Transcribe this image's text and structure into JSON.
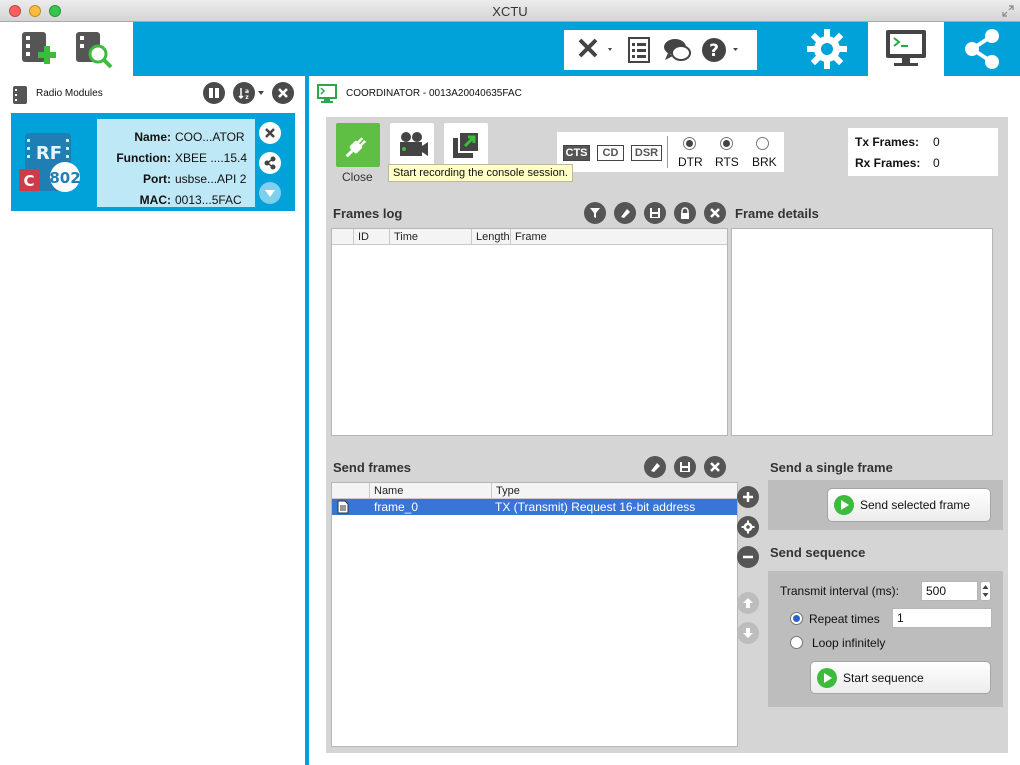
{
  "window": {
    "title": "XCTU"
  },
  "toolbar": {
    "icons": [
      "add-device-icon",
      "discover-devices-icon",
      "tools-icon",
      "frames-list-icon",
      "feedback-icon",
      "help-icon",
      "settings-icon",
      "console-icon",
      "network-icon"
    ],
    "accent": "#00a2d9"
  },
  "left": {
    "title": "Radio Modules",
    "module": {
      "badge_rf": "RF",
      "badge_c": "C",
      "badge_802": "802",
      "rows": [
        {
          "key": "Name:",
          "value": "COO...ATOR"
        },
        {
          "key": "Function:",
          "value": "XBEE ....15.4"
        },
        {
          "key": "Port:",
          "value": "usbse...API 2"
        },
        {
          "key": "MAC:",
          "value": "0013...5FAC"
        }
      ]
    }
  },
  "console": {
    "title": "COORDINATOR - 0013A20040635FAC",
    "close_label": "Close",
    "tooltip": "Start recording the console session.",
    "flow_labels": [
      "CTS",
      "CD",
      "DSR"
    ],
    "line_labels": [
      "DTR",
      "RTS",
      "BRK"
    ],
    "tx_label": "Tx Frames:",
    "tx_value": "0",
    "rx_label": "Rx Frames:",
    "rx_value": "0"
  },
  "frames_log": {
    "title": "Frames log",
    "columns": [
      "ID",
      "Time",
      "Length",
      "Frame"
    ],
    "details_title": "Frame details"
  },
  "send_frames": {
    "title": "Send frames",
    "columns": [
      "Name",
      "Type"
    ],
    "rows": [
      {
        "name": "frame_0",
        "type": "TX (Transmit) Request 16-bit address"
      }
    ],
    "single_title": "Send a single frame",
    "send_selected_label": "Send selected frame",
    "sequence_title": "Send sequence",
    "interval_label": "Transmit interval (ms):",
    "interval_value": "500",
    "repeat_label": "Repeat times",
    "repeat_value": "1",
    "loop_label": "Loop infinitely",
    "start_label": "Start sequence",
    "selection_color": "#3875d7"
  }
}
